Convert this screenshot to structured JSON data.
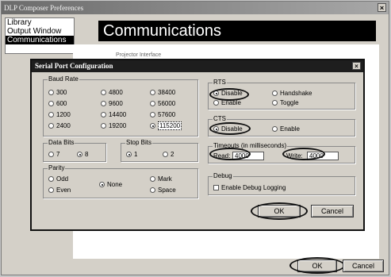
{
  "window": {
    "title": "DLP Composer Preferences",
    "close_glyph": "×"
  },
  "sidebar": {
    "items": [
      {
        "label": "Library"
      },
      {
        "label": "Output Window"
      },
      {
        "label": "Communications"
      }
    ]
  },
  "header": {
    "title": "Communications"
  },
  "background_fragment": "Projector Interface",
  "outer_buttons": {
    "ok": "OK",
    "cancel": "Cancel"
  },
  "dialog": {
    "title": "Serial Port Configuration",
    "close_glyph": "×",
    "baud_rate": {
      "label": "Baud Rate",
      "options": [
        "300",
        "4800",
        "38400",
        "600",
        "9600",
        "56000",
        "1200",
        "14400",
        "57600",
        "2400",
        "19200",
        "115200"
      ],
      "selected": "115200"
    },
    "data_bits": {
      "label": "Data Bits",
      "options": [
        "7",
        "8"
      ],
      "selected": "8"
    },
    "stop_bits": {
      "label": "Stop Bits",
      "options": [
        "1",
        "2"
      ],
      "selected": "1"
    },
    "parity": {
      "label": "Parity",
      "options": [
        "Odd",
        "Even",
        "None",
        "Mark",
        "Space"
      ],
      "selected": "None"
    },
    "rts": {
      "label": "RTS",
      "options": [
        "Disable",
        "Handshake",
        "Enable",
        "Toggle"
      ],
      "selected": "Disable"
    },
    "cts": {
      "label": "CTS",
      "options": [
        "Disable",
        "Enable"
      ],
      "selected": "Disable"
    },
    "timeouts": {
      "label": "Timeouts (in milliseconds)",
      "read_label": "Read:",
      "read_value": "4000",
      "write_label": "Write:",
      "write_value": "4000"
    },
    "debug": {
      "label": "Debug",
      "checkbox_label": "Enable Debug Logging",
      "checked": false
    },
    "buttons": {
      "ok": "OK",
      "cancel": "Cancel"
    }
  }
}
